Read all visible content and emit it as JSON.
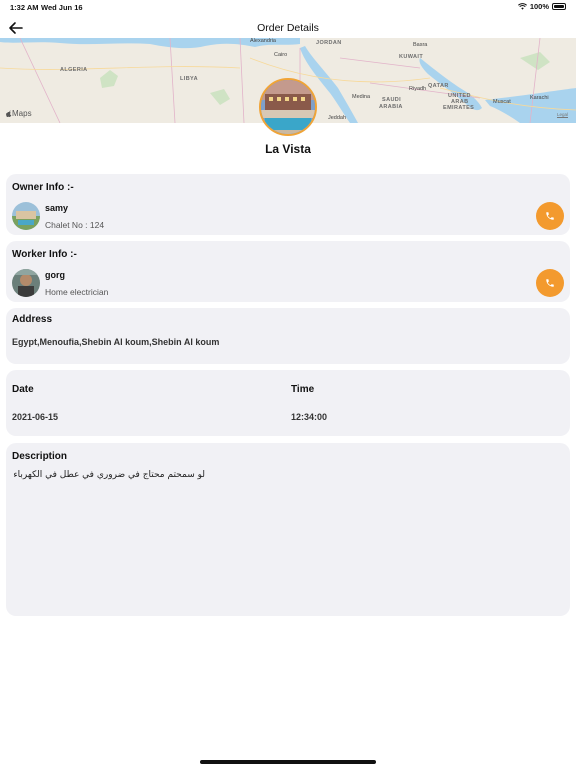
{
  "status_bar": {
    "time": "1:32 AM",
    "date": "Wed Jun 16",
    "battery": "100%"
  },
  "nav": {
    "title": "Order Details"
  },
  "map": {
    "attribution": "Maps",
    "legal": "Legal",
    "regions": [
      "ALGERIA",
      "LIBYA",
      "JORDAN",
      "KUWAIT",
      "QATAR",
      "SAUDI",
      "ARABIA",
      "UNITED",
      "ARAB",
      "EMIRATES"
    ],
    "cities": [
      "Alexandria",
      "Cairo",
      "Basra",
      "Medina",
      "Riyadh",
      "Muscat",
      "Karachi",
      "Jeddah"
    ]
  },
  "place": {
    "name": "La Vista"
  },
  "owner": {
    "heading": "Owner Info :-",
    "name": "samy",
    "detail": "Chalet No : 124"
  },
  "worker": {
    "heading": "Worker Info :-",
    "name": "gorg",
    "detail": "Home electrician"
  },
  "address": {
    "heading": "Address",
    "value": "Egypt,Menoufia,Shebin Al koum,Shebin Al koum"
  },
  "schedule": {
    "date_label": "Date",
    "date_value": "2021-06-15",
    "time_label": "Time",
    "time_value": "12:34:00"
  },
  "description": {
    "heading": "Description",
    "value": "لو سمحتم محتاج في ضروري في عطل في الكهرباء"
  },
  "colors": {
    "accent": "#f39a2e",
    "card_bg": "#f1f1f5"
  },
  "icons": {
    "back": "arrow-left-icon",
    "call": "phone-icon",
    "wifi": "wifi-icon",
    "battery": "battery-icon"
  }
}
